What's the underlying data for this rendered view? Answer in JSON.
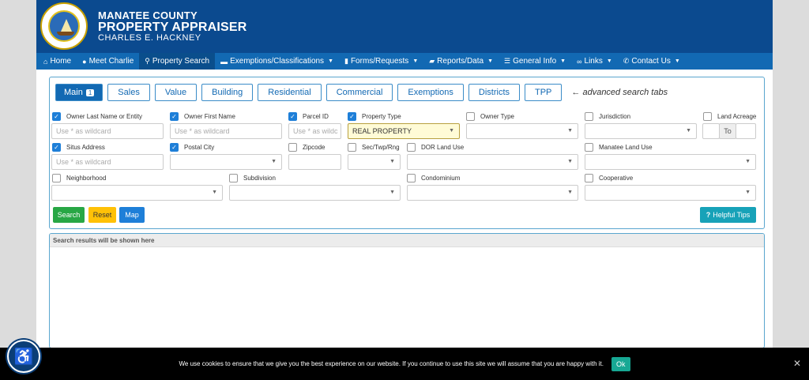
{
  "header": {
    "line1": "MANATEE COUNTY",
    "line2": "PROPERTY APPRAISER",
    "line3": "CHARLES E. HACKNEY"
  },
  "nav": [
    {
      "label": "Home",
      "icon": "home-icon"
    },
    {
      "label": "Meet Charlie",
      "icon": "user-icon"
    },
    {
      "label": "Property Search",
      "icon": "search-icon"
    },
    {
      "label": "Exemptions/Classifications",
      "icon": "card-icon"
    },
    {
      "label": "Forms/Requests",
      "icon": "file-icon"
    },
    {
      "label": "Reports/Data",
      "icon": "folder-icon"
    },
    {
      "label": "General Info",
      "icon": "list-icon"
    },
    {
      "label": "Links",
      "icon": "link-icon"
    },
    {
      "label": "Contact Us",
      "icon": "phone-icon"
    }
  ],
  "tabs": {
    "main": "Main",
    "main_badge": "1",
    "sales": "Sales",
    "value": "Value",
    "building": "Building",
    "residential": "Residential",
    "commercial": "Commercial",
    "exemptions": "Exemptions",
    "districts": "Districts",
    "tpp": "TPP",
    "note": "← advanced search tabs"
  },
  "fields": {
    "owner_last": "Owner Last Name or Entity",
    "owner_first": "Owner First Name",
    "parcel_id": "Parcel ID",
    "property_type": "Property Type",
    "owner_type": "Owner Type",
    "jurisdiction": "Jurisdiction",
    "land_acreage": "Land Acreage",
    "situs_address": "Situs Address",
    "postal_city": "Postal City",
    "zipcode": "Zipcode",
    "sec_twp_rng": "Sec/Twp/Rng",
    "dor_land_use": "DOR Land Use",
    "manatee_land_use": "Manatee Land Use",
    "neighborhood": "Neighborhood",
    "subdivision": "Subdivision",
    "condominium": "Condominium",
    "cooperative": "Cooperative"
  },
  "placeholders": {
    "wildcard": "Use * as wildcard",
    "wildcard_short": "Use * as wildc",
    "to": "To"
  },
  "values": {
    "property_type": "REAL PROPERTY"
  },
  "buttons": {
    "search": "Search",
    "reset": "Reset",
    "map": "Map",
    "helpful_tips": "Helpful Tips"
  },
  "results": {
    "header": "Search results will be shown here"
  },
  "cookie": {
    "message": "We use cookies to ensure that we give you the best experience on our website. If you continue to use this site we will assume that you are happy with it.",
    "ok": "Ok",
    "close": "✕"
  },
  "colors": {
    "header_bg": "#0b4a8f",
    "nav_bg": "#1269b3",
    "search_btn": "#28a745",
    "reset_btn": "#ffc107",
    "map_btn": "#1e7fd8",
    "tips_btn": "#17a2b8"
  }
}
